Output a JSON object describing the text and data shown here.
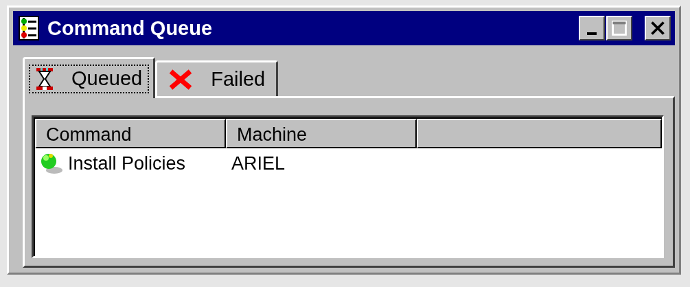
{
  "window": {
    "title": "Command Queue"
  },
  "tabs": [
    {
      "label": "Queued",
      "selected": true,
      "kind": "hourglass"
    },
    {
      "label": "Failed",
      "selected": false,
      "kind": "cross"
    }
  ],
  "table": {
    "columns": [
      "Command",
      "Machine"
    ],
    "rows": [
      {
        "command": "Install Policies",
        "machine": "ARIEL"
      }
    ]
  }
}
